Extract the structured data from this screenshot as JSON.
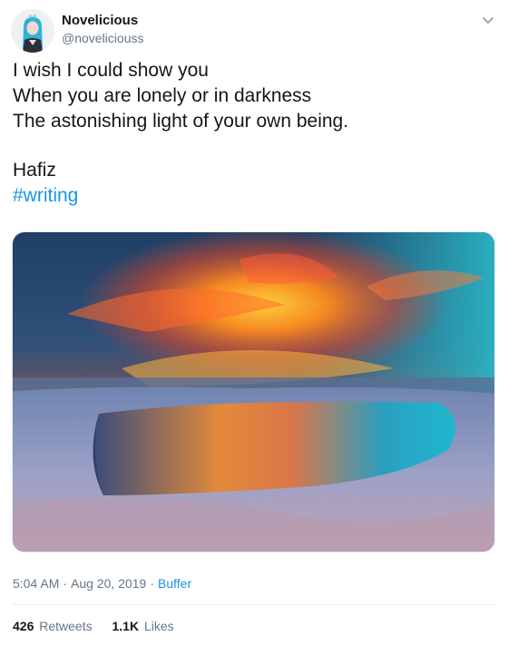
{
  "author": {
    "display_name": "Novelicious",
    "handle": "@noveliciouss"
  },
  "tweet": {
    "lines": [
      "I wish I could show you",
      "When you are lonely or in darkness",
      "The astonishing light of your own being."
    ],
    "signature": "Hafiz",
    "hashtag": "#writing"
  },
  "meta": {
    "time": "5:04 AM",
    "separator": "·",
    "date": "Aug 20, 2019",
    "source": "Buffer"
  },
  "stats": {
    "retweets_count": "426",
    "retweets_label": "Retweets",
    "likes_count": "1.1K",
    "likes_label": "Likes"
  },
  "icons": {
    "caret": "chevron-down-icon"
  },
  "colors": {
    "link": "#1b95e0",
    "secondary_text": "#657786",
    "primary_text": "#14171a"
  }
}
